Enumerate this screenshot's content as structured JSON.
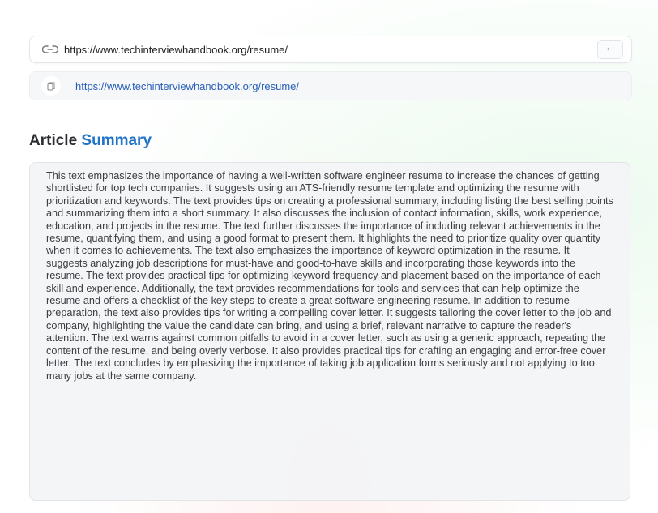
{
  "url_bar": {
    "value": "https://www.techinterviewhandbook.org/resume/",
    "icon": "link-icon",
    "submit_icon": "enter-icon"
  },
  "source": {
    "icon": "document-icon",
    "url": "https://www.techinterviewhandbook.org/resume/"
  },
  "heading": {
    "prefix": "Article",
    "accent": "Summary",
    "accent_color": "#2174c7"
  },
  "summary": {
    "text": "This text emphasizes the importance of having a well-written software engineer resume to increase the chances of getting shortlisted for top tech companies. It suggests using an ATS-friendly resume template and optimizing the resume with prioritization and keywords. The text provides tips on creating a professional summary, including listing the best selling points and summarizing them into a short summary. It also discusses the inclusion of contact information, skills, work experience, education, and projects in the resume. The text further discusses the importance of including relevant achievements in the resume, quantifying them, and using a good format to present them. It highlights the need to prioritize quality over quantity when it comes to achievements. The text also emphasizes the importance of keyword optimization in the resume. It suggests analyzing job descriptions for must-have and good-to-have skills and incorporating those keywords into the resume. The text provides practical tips for optimizing keyword frequency and placement based on the importance of each skill and experience. Additionally, the text provides recommendations for tools and services that can help optimize the resume and offers a checklist of the key steps to create a great software engineering resume. In addition to resume preparation, the text also provides tips for writing a compelling cover letter. It suggests tailoring the cover letter to the job and company, highlighting the value the candidate can bring, and using a brief, relevant narrative to capture the reader's attention. The text warns against common pitfalls to avoid in a cover letter, such as using a generic approach, repeating the content of the resume, and being overly verbose. It also provides practical tips for crafting an engaging and error-free cover letter. The text concludes by emphasizing the importance of taking job application forms seriously and not applying to too many jobs at the same company."
  }
}
